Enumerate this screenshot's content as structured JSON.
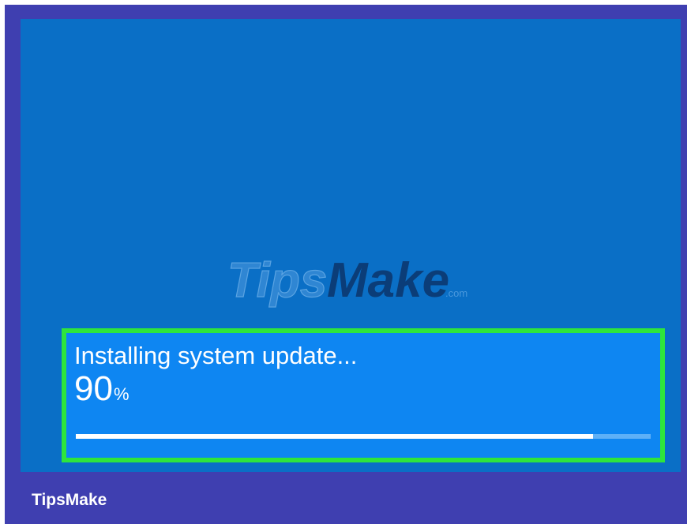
{
  "screen": {
    "watermark": {
      "part1": "Tips",
      "part2": "Make",
      "suffix": ".com"
    },
    "update": {
      "title": "Installing system update...",
      "percent_value": "90",
      "percent_sign": "%",
      "progress_fraction": 0.9
    }
  },
  "footer": {
    "brand": "TipsMake"
  },
  "colors": {
    "frame": "#3f3fb0",
    "screen": "#0a6fc6",
    "update_box": "#0e86f2",
    "highlight_border": "#2ee53c",
    "progress_fill": "#ffffff",
    "progress_track": "#5eb0f7"
  }
}
